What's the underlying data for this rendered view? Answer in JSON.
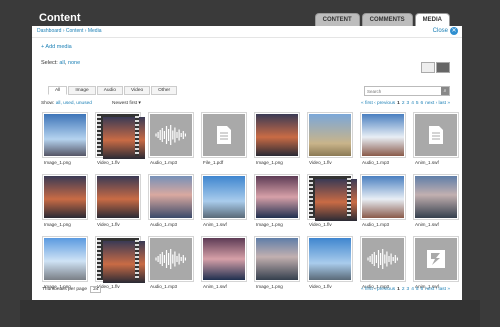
{
  "page": {
    "title": "Content"
  },
  "tabs": [
    {
      "label": "CONTENT"
    },
    {
      "label": "COMMENTS"
    },
    {
      "label": "MEDIA"
    }
  ],
  "breadcrumb": "Dashboard › Content › Media",
  "close": {
    "label": "Close",
    "icon": "close-icon"
  },
  "add_media": "+ Add media",
  "select": {
    "label": "Select:",
    "all": "all",
    "none": "none"
  },
  "filter_tabs": [
    "All",
    "Image",
    "Audio",
    "Video",
    "Other"
  ],
  "search": {
    "placeholder": "Search"
  },
  "show": {
    "label": "Show:",
    "options": "all, used, unused"
  },
  "sort": {
    "label": "Newest first"
  },
  "pager": {
    "prev": "« first ‹ previous",
    "pages": [
      "1",
      "2",
      "3",
      "4",
      "5",
      "6"
    ],
    "current": "1",
    "next": "next › last »"
  },
  "items": [
    {
      "caption": "Image_1.png",
      "kind": "t-sky1"
    },
    {
      "caption": "Video_1.flv",
      "kind": "film"
    },
    {
      "caption": "Audio_1.mp3",
      "kind": "audio"
    },
    {
      "caption": "File_1.pdf",
      "kind": "file"
    },
    {
      "caption": "Image_1.png",
      "kind": "t-sunset"
    },
    {
      "caption": "Video_1.flv",
      "kind": "t-pyramid"
    },
    {
      "caption": "Audio_1.mp3",
      "kind": "t-cloud"
    },
    {
      "caption": "Anim_1.swf",
      "kind": "file"
    },
    {
      "caption": "Image_1.png",
      "kind": "t-sunset"
    },
    {
      "caption": "Video_1.flv",
      "kind": "t-sunset"
    },
    {
      "caption": "Audio_1.mp3",
      "kind": "t-lake"
    },
    {
      "caption": "Anim_1.swf",
      "kind": "t-coast"
    },
    {
      "caption": "Image_1.png",
      "kind": "t-pink"
    },
    {
      "caption": "Video_1.flv",
      "kind": "film"
    },
    {
      "caption": "Audio_1.mp3",
      "kind": "t-cloud"
    },
    {
      "caption": "Anim_1.swf",
      "kind": "t-rock"
    },
    {
      "caption": "Image_1.png",
      "kind": "t-plain"
    },
    {
      "caption": "Video_1.flv",
      "kind": "film"
    },
    {
      "caption": "Audio_1.mp3",
      "kind": "audio"
    },
    {
      "caption": "Anim_1.swf",
      "kind": "t-pink"
    },
    {
      "caption": "Image_1.png",
      "kind": "t-rock"
    },
    {
      "caption": "Video_1.flv",
      "kind": "t-coast"
    },
    {
      "caption": "Audio_1.mp3",
      "kind": "audio"
    },
    {
      "caption": "Anim_1.swf",
      "kind": "swf"
    }
  ],
  "thumbnails_per_page": {
    "label": "Thumbnails per page",
    "value": "24"
  }
}
